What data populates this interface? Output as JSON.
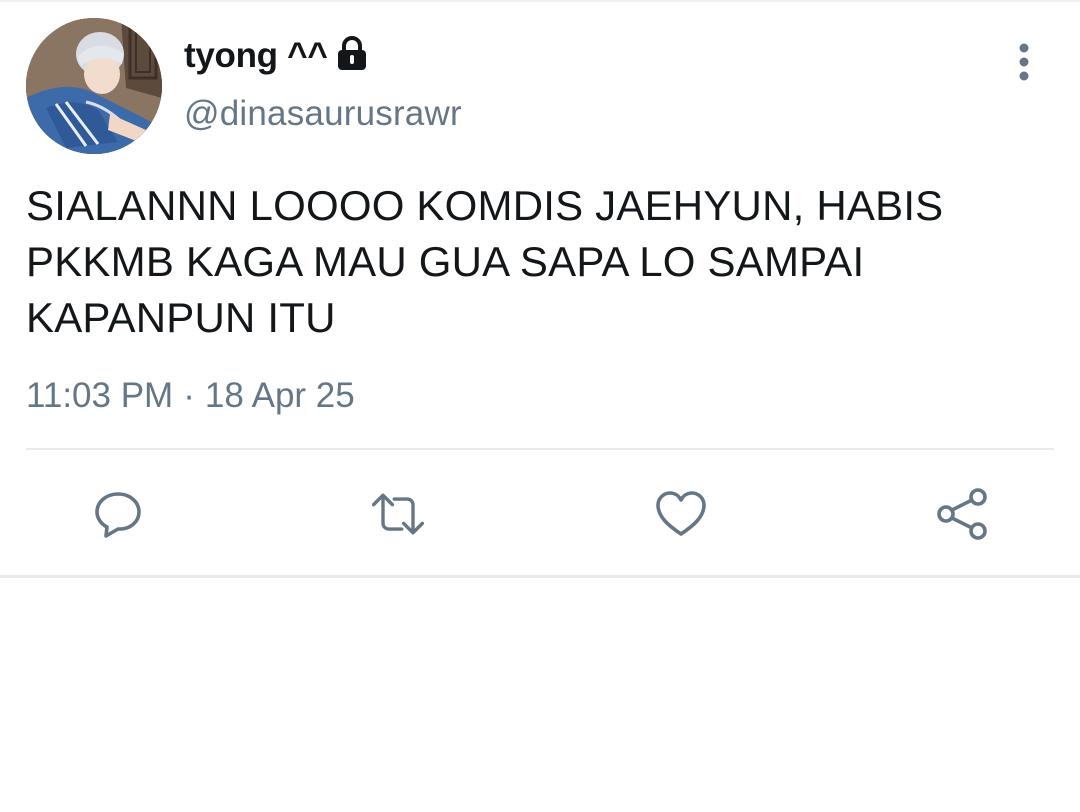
{
  "tweet": {
    "display_name": "tyong ^^",
    "handle": "@dinasaurusrawr",
    "text_lines": [
      "SIALANNN LOOOO KOMDIS JAEHYUN, HABIS",
      "PKKMB KAGA MAU GUA SAPA LO SAMPAI",
      "KAPANPUN ITU"
    ],
    "time": "11:03 PM",
    "separator": "·",
    "date": "18 Apr 25",
    "protected_icon": "lock-icon"
  },
  "header": {
    "more_icon": "more-vertical-icon"
  },
  "actions": [
    {
      "name": "reply",
      "icon": "reply-icon"
    },
    {
      "name": "retweet",
      "icon": "retweet-icon"
    },
    {
      "name": "like",
      "icon": "heart-icon"
    },
    {
      "name": "share",
      "icon": "share-icon"
    }
  ],
  "colors": {
    "primary_text": "#14171a",
    "secondary_text": "#657786",
    "divider": "#e6ecf0"
  }
}
